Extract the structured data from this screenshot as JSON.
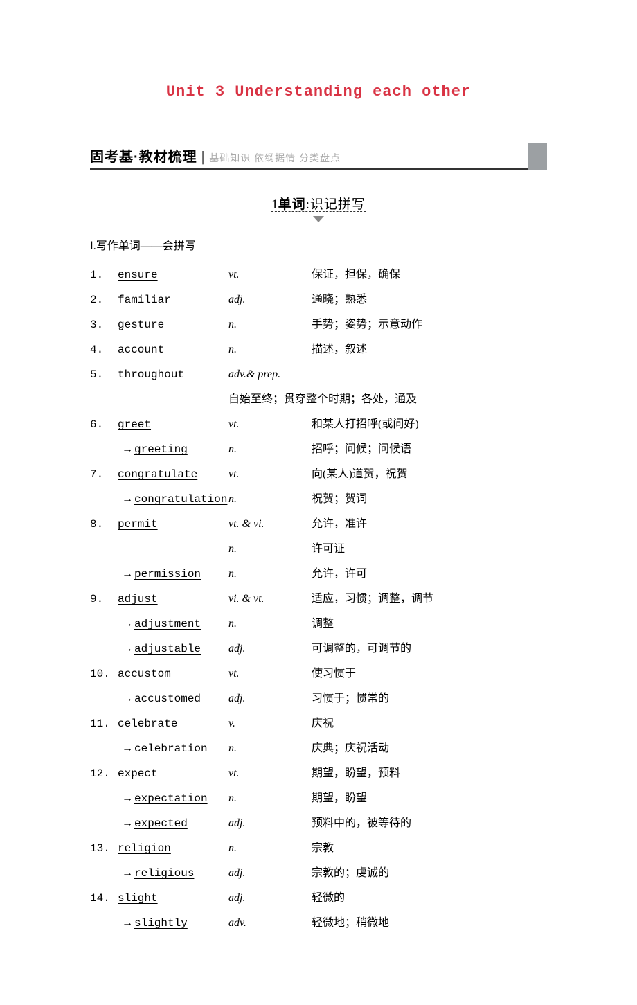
{
  "title": "Unit 3  Understanding each other",
  "section": {
    "main": "固考基·教材梳理",
    "sep": "|",
    "sub": "基础知识  依纲据情  分类盘点"
  },
  "subheading": {
    "num": "1",
    "bold": "单词",
    "rest": ":识记拼写"
  },
  "groupTitle": "Ⅰ.写作单词——会拼写",
  "entries": [
    {
      "num": "1.",
      "word": "ensure",
      "pos": "vt.",
      "def": "保证，担保，确保"
    },
    {
      "num": "2.",
      "word": "familiar",
      "pos": "adj.",
      "def": "通晓；熟悉"
    },
    {
      "num": "3.",
      "word": "gesture",
      "pos": "n.",
      "def": "手势；姿势；示意动作"
    },
    {
      "num": "4.",
      "word": "account",
      "pos": "n.",
      "def": "描述，叙述"
    },
    {
      "num": "5.",
      "word": "throughout",
      "pos": "adv.& prep.",
      "def": "",
      "defBelow": "自始至终；贯穿整个时期；各处，通及"
    },
    {
      "num": "6.",
      "word": "greet",
      "pos": "vt.",
      "def": "和某人打招呼(或问好)"
    },
    {
      "derive": true,
      "word": "greeting",
      "pos": "n.",
      "def": "招呼；问候；问候语"
    },
    {
      "num": "7.",
      "word": "congratulate",
      "pos": "vt.",
      "def": "向(某人)道贺，祝贺"
    },
    {
      "derive": true,
      "word": "congratulation",
      "pos": "n.",
      "def": "祝贺；贺词"
    },
    {
      "num": "8.",
      "word": "permit",
      "pos": "vt. & vi.",
      "def": "允许，准许"
    },
    {
      "blank": true,
      "pos": "n.",
      "def": "许可证"
    },
    {
      "derive": true,
      "word": "permission",
      "pos": "n.",
      "def": "允许，许可"
    },
    {
      "num": "9.",
      "word": "adjust",
      "pos": "vi. & vt.",
      "def": "适应，习惯；调整，调节"
    },
    {
      "derive": true,
      "word": "adjustment",
      "pos": "n.",
      "def": "调整"
    },
    {
      "derive": true,
      "word": "adjustable",
      "pos": "adj.",
      "def": "可调整的，可调节的"
    },
    {
      "num": "10.",
      "word": "accustom",
      "pos": "vt.",
      "def": "使习惯于"
    },
    {
      "derive": true,
      "word": "accustomed ",
      "pos": "adj.",
      "def": "习惯于；惯常的"
    },
    {
      "num": "11.",
      "word": "celebrate",
      "pos": "v.",
      "def": "庆祝"
    },
    {
      "derive": true,
      "word": "celebration",
      "pos": "n.",
      "def": "庆典；庆祝活动"
    },
    {
      "num": "12.",
      "word": " expect",
      "pos": "vt.",
      "def": "期望，盼望，预料"
    },
    {
      "derive": true,
      "word": "expectation",
      "pos": "n.",
      "def": "期望，盼望"
    },
    {
      "derive": true,
      "word": "expected",
      "pos": "adj.",
      "def": "预料中的，被等待的"
    },
    {
      "num": "13.",
      "word": "religion",
      "pos": "n.",
      "def": "宗教"
    },
    {
      "derive": true,
      "word": "religious",
      "pos": "adj.",
      "def": "宗教的；虔诚的"
    },
    {
      "num": "14.",
      "word": "slight",
      "pos": "adj.",
      "def": "轻微的"
    },
    {
      "derive": true,
      "word": "slightly",
      "pos": "adv.",
      "def": "轻微地；稍微地"
    }
  ]
}
